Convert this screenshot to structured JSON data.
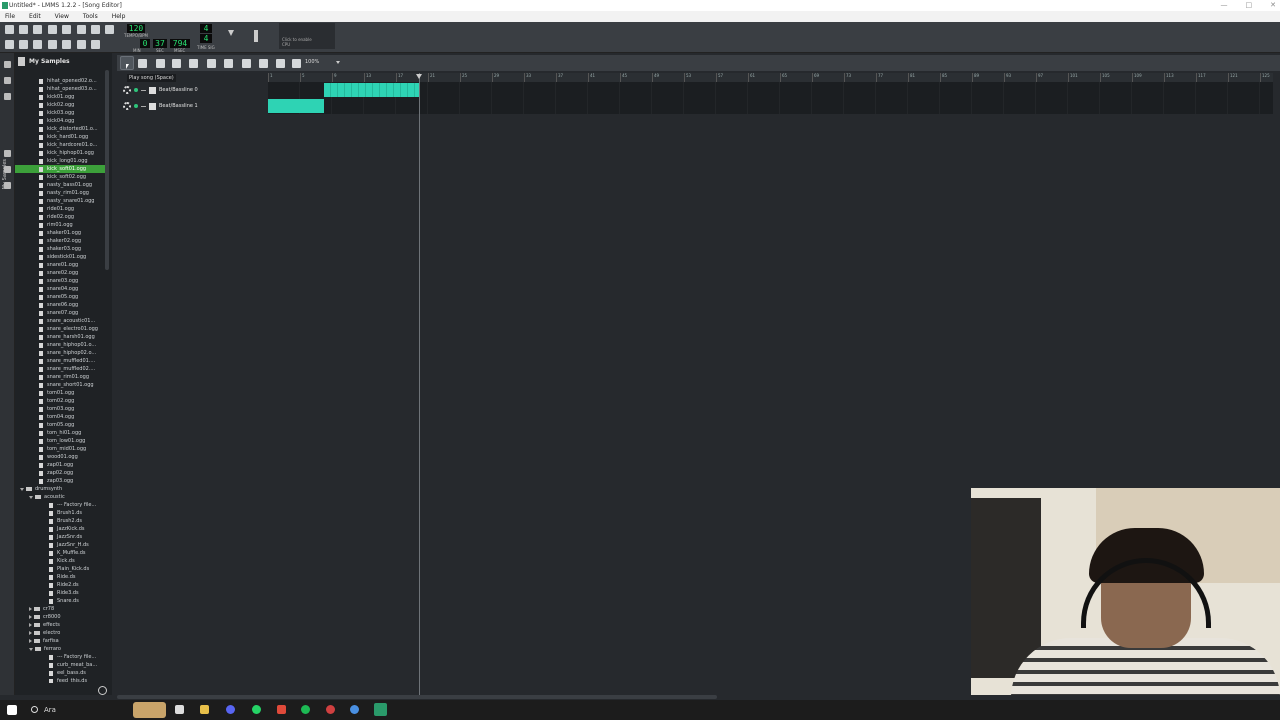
{
  "window": {
    "title": "Untitled* - LMMS 1.2.2 - [Song Editor]"
  },
  "menu": [
    "File",
    "Edit",
    "View",
    "Tools",
    "Help"
  ],
  "transport": {
    "tempo": "120",
    "tempo_label": "TEMPO/BPM",
    "min": "0",
    "sec": "37",
    "msec": "794",
    "min_label": "MIN",
    "sec_label": "SEC",
    "msec_label": "MSEC",
    "timesig_num": "4",
    "timesig_den": "4",
    "timesig_label": "TIME SIG",
    "cpu_hint": "Click to enable",
    "cpu_label": "CPU"
  },
  "browser": {
    "title": "My Samples",
    "tab_label": "My Samples",
    "items": [
      {
        "t": "hihat_opened02.o...",
        "k": "file"
      },
      {
        "t": "hihat_opened03.o...",
        "k": "file"
      },
      {
        "t": "kick01.ogg",
        "k": "file"
      },
      {
        "t": "kick02.ogg",
        "k": "file"
      },
      {
        "t": "kick03.ogg",
        "k": "file"
      },
      {
        "t": "kick04.ogg",
        "k": "file"
      },
      {
        "t": "kick_distorted01.o...",
        "k": "file"
      },
      {
        "t": "kick_hard01.ogg",
        "k": "file"
      },
      {
        "t": "kick_hardcore01.o...",
        "k": "file"
      },
      {
        "t": "kick_hiphop01.ogg",
        "k": "file"
      },
      {
        "t": "kick_long01.ogg",
        "k": "file"
      },
      {
        "t": "kick_soft01.ogg",
        "k": "file",
        "sel": true
      },
      {
        "t": "kick_soft02.ogg",
        "k": "file"
      },
      {
        "t": "nasty_bass01.ogg",
        "k": "file"
      },
      {
        "t": "nasty_rim01.ogg",
        "k": "file"
      },
      {
        "t": "nasty_snare01.ogg",
        "k": "file"
      },
      {
        "t": "ride01.ogg",
        "k": "file"
      },
      {
        "t": "ride02.ogg",
        "k": "file"
      },
      {
        "t": "rim01.ogg",
        "k": "file"
      },
      {
        "t": "shaker01.ogg",
        "k": "file"
      },
      {
        "t": "shaker02.ogg",
        "k": "file"
      },
      {
        "t": "shaker03.ogg",
        "k": "file"
      },
      {
        "t": "sidestick01.ogg",
        "k": "file"
      },
      {
        "t": "snare01.ogg",
        "k": "file"
      },
      {
        "t": "snare02.ogg",
        "k": "file"
      },
      {
        "t": "snare03.ogg",
        "k": "file"
      },
      {
        "t": "snare04.ogg",
        "k": "file"
      },
      {
        "t": "snare05.ogg",
        "k": "file"
      },
      {
        "t": "snare06.ogg",
        "k": "file"
      },
      {
        "t": "snare07.ogg",
        "k": "file"
      },
      {
        "t": "snare_acoustic01...",
        "k": "file"
      },
      {
        "t": "snare_electro01.ogg",
        "k": "file"
      },
      {
        "t": "snare_harsh01.ogg",
        "k": "file"
      },
      {
        "t": "snare_hiphop01.o...",
        "k": "file"
      },
      {
        "t": "snare_hiphop02.o...",
        "k": "file"
      },
      {
        "t": "snare_muffled01....",
        "k": "file"
      },
      {
        "t": "snare_muffled02....",
        "k": "file"
      },
      {
        "t": "snare_rim01.ogg",
        "k": "file"
      },
      {
        "t": "snare_short01.ogg",
        "k": "file"
      },
      {
        "t": "tom01.ogg",
        "k": "file"
      },
      {
        "t": "tom02.ogg",
        "k": "file"
      },
      {
        "t": "tom03.ogg",
        "k": "file"
      },
      {
        "t": "tom04.ogg",
        "k": "file"
      },
      {
        "t": "tom05.ogg",
        "k": "file"
      },
      {
        "t": "tom_hi01.ogg",
        "k": "file"
      },
      {
        "t": "tom_low01.ogg",
        "k": "file"
      },
      {
        "t": "tom_mid01.ogg",
        "k": "file"
      },
      {
        "t": "wood01.ogg",
        "k": "file"
      },
      {
        "t": "zap01.ogg",
        "k": "file"
      },
      {
        "t": "zap02.ogg",
        "k": "file"
      },
      {
        "t": "zap03.ogg",
        "k": "file"
      },
      {
        "t": "drumsynth",
        "k": "folder-open",
        "lvl": 0
      },
      {
        "t": "acoustic",
        "k": "folder-open",
        "lvl": 1
      },
      {
        "t": "--- Factory file...",
        "k": "file",
        "lvl": 2
      },
      {
        "t": "Brush1.ds",
        "k": "file",
        "lvl": 2
      },
      {
        "t": "Brush2.ds",
        "k": "file",
        "lvl": 2
      },
      {
        "t": "JazzKick.ds",
        "k": "file",
        "lvl": 2
      },
      {
        "t": "JazzSnr.ds",
        "k": "file",
        "lvl": 2
      },
      {
        "t": "JazzSnr_H.ds",
        "k": "file",
        "lvl": 2
      },
      {
        "t": "K_Muffle.ds",
        "k": "file",
        "lvl": 2
      },
      {
        "t": "Kick.ds",
        "k": "file",
        "lvl": 2
      },
      {
        "t": "Plain_Kick.ds",
        "k": "file",
        "lvl": 2
      },
      {
        "t": "Ride.ds",
        "k": "file",
        "lvl": 2
      },
      {
        "t": "Ride2.ds",
        "k": "file",
        "lvl": 2
      },
      {
        "t": "Ride3.ds",
        "k": "file",
        "lvl": 2
      },
      {
        "t": "Snare.ds",
        "k": "file",
        "lvl": 2
      },
      {
        "t": "cr78",
        "k": "folder",
        "lvl": 1
      },
      {
        "t": "cr8000",
        "k": "folder",
        "lvl": 1
      },
      {
        "t": "effects",
        "k": "folder",
        "lvl": 1
      },
      {
        "t": "electro",
        "k": "folder",
        "lvl": 1
      },
      {
        "t": "farfisa",
        "k": "folder",
        "lvl": 1
      },
      {
        "t": "ferraro",
        "k": "folder-open",
        "lvl": 1
      },
      {
        "t": "--- Factory file...",
        "k": "file",
        "lvl": 2
      },
      {
        "t": "curb_meat_ba...",
        "k": "file",
        "lvl": 2
      },
      {
        "t": "eel_bass.ds",
        "k": "file",
        "lvl": 2
      },
      {
        "t": "feed_this.ds",
        "k": "file",
        "lvl": 2
      }
    ]
  },
  "song_editor": {
    "zoom": "100%",
    "tooltip": "Play song (Space)",
    "timeline_ticks": [
      "1",
      "5",
      "9",
      "13",
      "17",
      "21",
      "25",
      "29",
      "33",
      "37",
      "41",
      "45",
      "49",
      "53",
      "57",
      "61",
      "65",
      "69",
      "73",
      "77",
      "81",
      "85",
      "89",
      "93",
      "97",
      "101",
      "105",
      "109",
      "113",
      "117",
      "121",
      "125"
    ],
    "tracks": [
      {
        "name": "Beat/Bassline 0"
      },
      {
        "name": "Beat/Bassline 1"
      }
    ]
  },
  "taskbar": {
    "search_placeholder": "Ara"
  },
  "colors": {
    "accent": "#2ed3b4",
    "selection": "#3ca03a",
    "lcd": "#28e070"
  }
}
